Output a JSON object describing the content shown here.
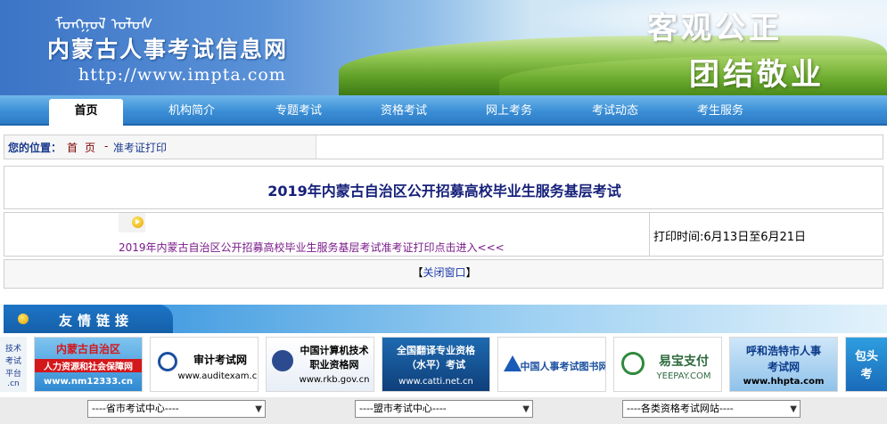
{
  "header": {
    "mongolian_script": "ᠮᠣᠩᠭᠣᠯ ᠤᠯᠤᠰ",
    "site_title": "内蒙古人事考试信息网",
    "site_url": "http://www.impta.com",
    "slogan_line1": "客观公正",
    "slogan_line2": "团结敬业"
  },
  "nav": {
    "items": [
      {
        "label": "首页"
      },
      {
        "label": "机构简介"
      },
      {
        "label": "专题考试"
      },
      {
        "label": "资格考试"
      },
      {
        "label": "网上考务"
      },
      {
        "label": "考试动态"
      },
      {
        "label": "考生服务"
      }
    ]
  },
  "breadcrumb": {
    "label": "您的位置：",
    "home": "首页",
    "separator": "-",
    "current": "准考证打印"
  },
  "main": {
    "title": "2019年内蒙古自治区公开招募高校毕业生服务基层考试",
    "print_link": "2019年内蒙古自治区公开招募高校毕业生服务基层考试准考证打印点击进入<<<",
    "print_time": "打印时间:6月13日至6月21日",
    "close_prefix": "【",
    "close_label": "关闭窗口",
    "close_suffix": "】"
  },
  "friends": {
    "title": "友情链接",
    "partial_left": [
      "技术",
      "考试",
      "平台",
      ".cn"
    ],
    "logos": [
      {
        "line1": "内蒙古自治区",
        "line2": "人力资源和社会保障网",
        "line3": "www.nm12333.cn"
      },
      {
        "line1": "审计考试网",
        "line2": "www.auditexam.cn"
      },
      {
        "line1": "中国计算机技术",
        "line2": "职业资格网",
        "line3": "www.rkb.gov.cn"
      },
      {
        "line1": "全国翻译专业资格",
        "line2": "（水平）考试",
        "line3": "www.catti.net.cn"
      },
      {
        "line1": "中国人事考试图书网"
      },
      {
        "line1": "易宝支付",
        "line2": "YEEPAY.COM"
      },
      {
        "line1": "呼和浩特市人事",
        "line2": "考试网",
        "line3": "www.hhpta.com"
      },
      {
        "line1": "包头",
        "line2": "考"
      }
    ],
    "selects": [
      {
        "value": "----省市考试中心----"
      },
      {
        "value": "----盟市考试中心----"
      },
      {
        "value": "----各类资格考试网站----"
      }
    ]
  },
  "colors": {
    "nav_blue": "#3b8fd6",
    "title_navy": "#16207a",
    "link_purple": "#7a1a8a"
  }
}
